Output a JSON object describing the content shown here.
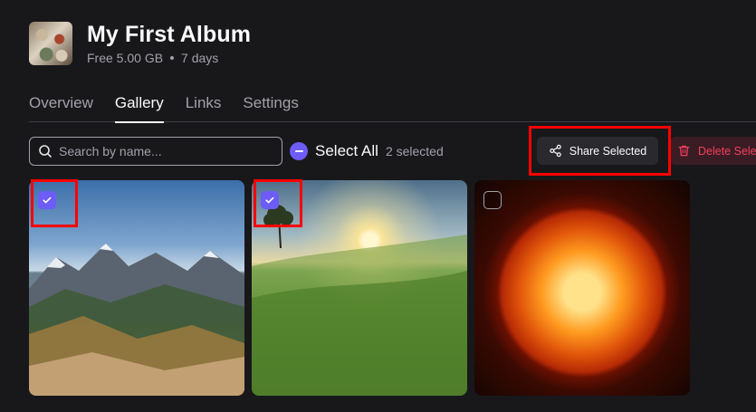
{
  "album": {
    "title": "My First Album",
    "storage": "Free 5.00 GB",
    "duration": "7 days"
  },
  "tabs": [
    {
      "label": "Overview",
      "active": false
    },
    {
      "label": "Gallery",
      "active": true
    },
    {
      "label": "Links",
      "active": false
    },
    {
      "label": "Settings",
      "active": false
    }
  ],
  "toolbar": {
    "search_placeholder": "Search by name...",
    "search_value": "",
    "select_all_label": "Select All",
    "selected_count": "2 selected",
    "share_label": "Share Selected",
    "delete_label": "Delete Sele"
  },
  "gallery": [
    {
      "name": "mountain-landscape",
      "selected": true
    },
    {
      "name": "green-meadow-sunset",
      "selected": true
    },
    {
      "name": "burning-sun",
      "selected": false
    }
  ],
  "colors": {
    "accent": "#6d5cf5",
    "danger": "#f43f5e",
    "highlight": "#ff0000",
    "background": "#18181b"
  }
}
